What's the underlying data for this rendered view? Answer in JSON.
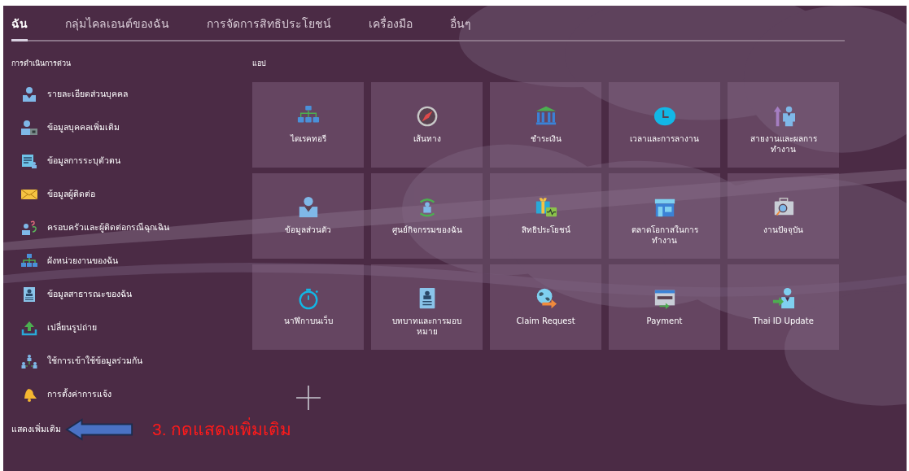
{
  "tabs": [
    {
      "label": "ฉัน",
      "selected": true
    },
    {
      "label": "กลุ่มไคลเอนต์ของฉัน",
      "selected": false
    },
    {
      "label": "การจัดการสิทธิประโยชน์",
      "selected": false
    },
    {
      "label": "เครื่องมือ",
      "selected": false
    },
    {
      "label": "อื่นๆ",
      "selected": false
    }
  ],
  "quick_actions": {
    "title": "การดำเนินการด่วน",
    "items": [
      {
        "label": "รายละเอียดส่วนบุคคล"
      },
      {
        "label": "ข้อมูลบุคคลเพิ่มเติม"
      },
      {
        "label": "ข้อมูลการระบุตัวตน"
      },
      {
        "label": "ข้อมูลผู้ติดต่อ"
      },
      {
        "label": "ครอบครัวและผู้ติดต่อกรณีฉุกเฉิน"
      },
      {
        "label": "ผังหน่วยงานของฉัน"
      },
      {
        "label": "ข้อมูลสาธารณะของฉัน"
      },
      {
        "label": "เปลี่ยนรูปถ่าย"
      },
      {
        "label": "ใช้การเข้าใช้ข้อมูลร่วมกัน"
      },
      {
        "label": "การตั้งค่าการแจ้ง"
      }
    ],
    "show_more": "แสดงเพิ่มเติม"
  },
  "apps": {
    "title": "แอป",
    "tiles": [
      {
        "label": "ไดเรคทอรี"
      },
      {
        "label": "เส้นทาง"
      },
      {
        "label": "ชำระเงิน"
      },
      {
        "label": "เวลาและการลางาน"
      },
      {
        "label": "สายงานและผลการทำงาน"
      },
      {
        "label": "ข้อมูลส่วนตัว"
      },
      {
        "label": "ศูนย์กิจกรรมของฉัน"
      },
      {
        "label": "สิทธิประโยชน์"
      },
      {
        "label": "ตลาดโอกาสในการทำงาน"
      },
      {
        "label": "งานปัจจุบัน"
      },
      {
        "label": "นาฬิกาบนเว็บ"
      },
      {
        "label": "บทบาทและการมอบหมาย"
      },
      {
        "label": "Claim Request"
      },
      {
        "label": "Payment"
      },
      {
        "label": "Thai ID Update"
      }
    ]
  },
  "annotation": {
    "text": "3. กดแสดงเพิ่มเติม"
  }
}
